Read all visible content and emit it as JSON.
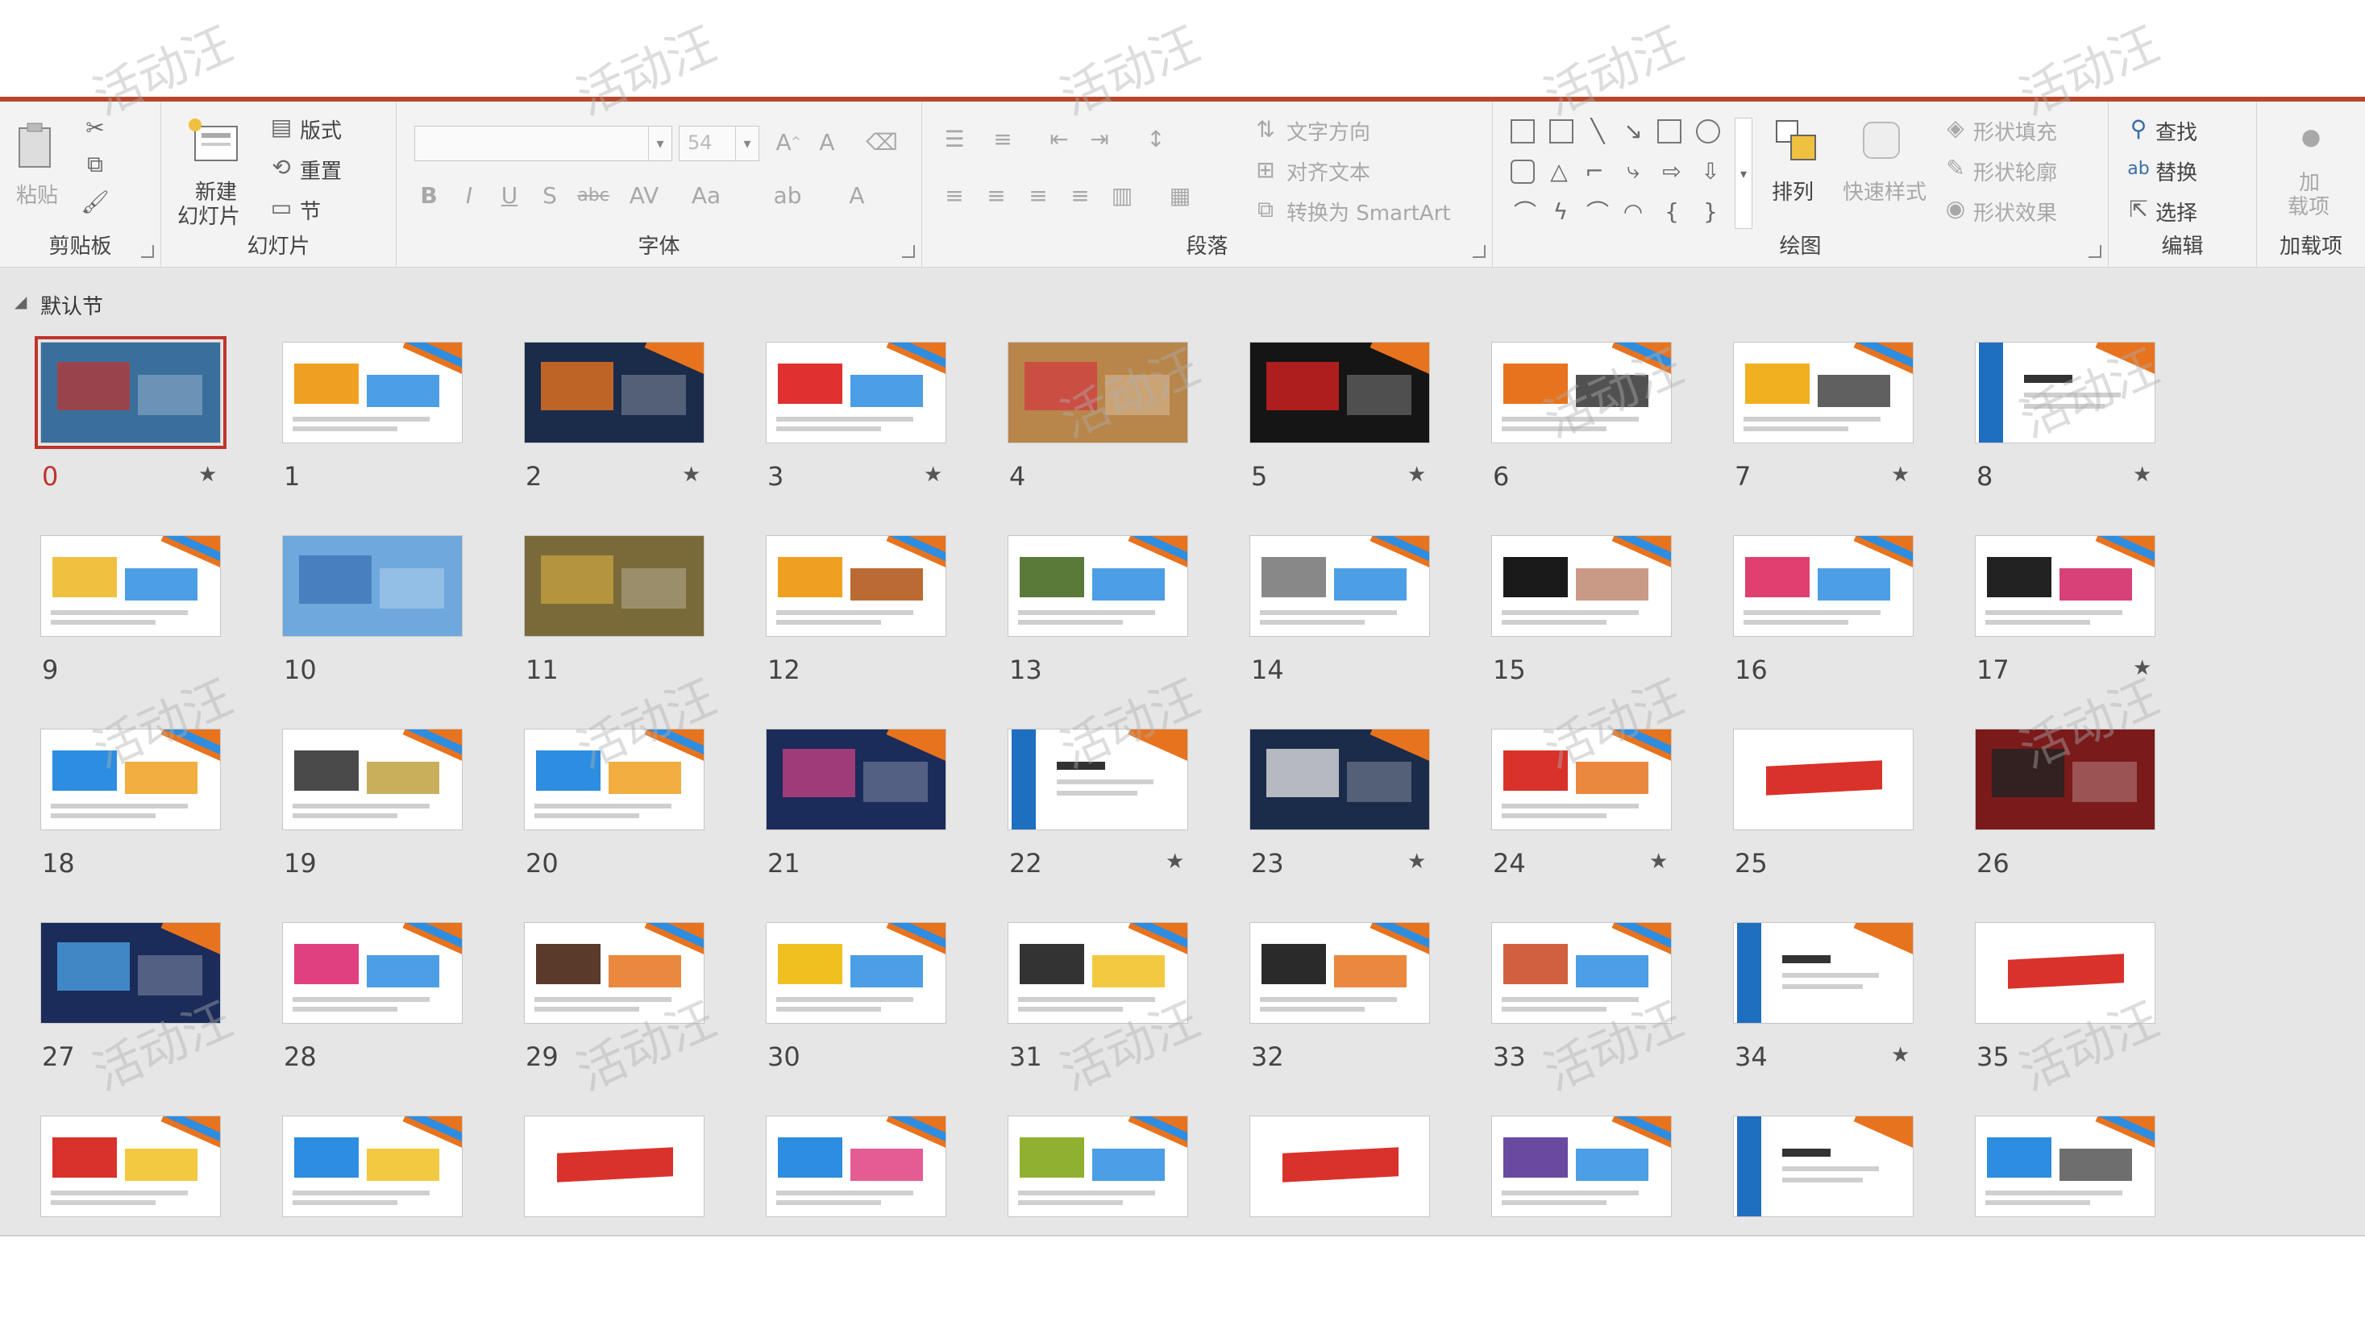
{
  "ribbon": {
    "clipboard": {
      "label": "剪贴板",
      "paste": "粘贴"
    },
    "slides": {
      "label": "幻灯片",
      "new_slide_line1": "新建",
      "new_slide_line2": "幻灯片",
      "layout": "版式",
      "reset": "重置",
      "section": "节"
    },
    "font": {
      "label": "字体",
      "font_name": "",
      "font_size": "54"
    },
    "paragraph": {
      "label": "段落",
      "text_direction": "文字方向",
      "align_text": "对齐文本",
      "convert_smartart": "转换为 SmartArt"
    },
    "drawing": {
      "label": "绘图",
      "arrange": "排列",
      "quick_styles": "快速样式",
      "shape_fill": "形状填充",
      "shape_outline": "形状轮廓",
      "shape_effects": "形状效果"
    },
    "editing": {
      "label": "编辑",
      "find": "查找",
      "replace": "替换",
      "select": "选择"
    },
    "addins": {
      "label": "加载项",
      "btn_line1": "加",
      "btn_line2": "载项"
    }
  },
  "section": {
    "name": "默认节"
  },
  "slides": [
    {
      "n": "0",
      "star": true,
      "style": "photo",
      "c1": "#3a6f9c",
      "c2": "#b23a3a"
    },
    {
      "n": "1",
      "star": false,
      "style": "white",
      "c1": "#f0a020",
      "c2": "#2d8de0"
    },
    {
      "n": "2",
      "star": true,
      "style": "dark",
      "c1": "#1b2b4a",
      "c2": "#e8731e"
    },
    {
      "n": "3",
      "star": true,
      "style": "white",
      "c1": "#e03030",
      "c2": "#2d8de0"
    },
    {
      "n": "4",
      "star": false,
      "style": "photo",
      "c1": "#b8864a",
      "c2": "#d04040"
    },
    {
      "n": "5",
      "star": true,
      "style": "dark",
      "c1": "#151515",
      "c2": "#d42020"
    },
    {
      "n": "6",
      "star": false,
      "style": "white",
      "c1": "#e8731e",
      "c2": "#333333"
    },
    {
      "n": "7",
      "star": true,
      "style": "white",
      "c1": "#f0b020",
      "c2": "#444444"
    },
    {
      "n": "8",
      "star": true,
      "style": "film",
      "c1": "#1f6fc0",
      "c2": "#e8731e"
    },
    {
      "n": "9",
      "star": false,
      "style": "white",
      "c1": "#f0c040",
      "c2": "#2d8de0"
    },
    {
      "n": "10",
      "star": false,
      "style": "photo",
      "c1": "#6fa8dc",
      "c2": "#3f76b8"
    },
    {
      "n": "11",
      "star": false,
      "style": "photo",
      "c1": "#7a6a3a",
      "c2": "#c0a040"
    },
    {
      "n": "12",
      "star": false,
      "style": "white",
      "c1": "#f0a020",
      "c2": "#b05010"
    },
    {
      "n": "13",
      "star": false,
      "style": "white",
      "c1": "#5a7a3a",
      "c2": "#2d8de0"
    },
    {
      "n": "14",
      "star": false,
      "style": "white",
      "c1": "#888888",
      "c2": "#2d8de0"
    },
    {
      "n": "15",
      "star": false,
      "style": "white",
      "c1": "#1a1a1a",
      "c2": "#c08870"
    },
    {
      "n": "16",
      "star": false,
      "style": "white",
      "c1": "#e04070",
      "c2": "#2d8de0"
    },
    {
      "n": "17",
      "star": true,
      "style": "white",
      "c1": "#222222",
      "c2": "#d02060"
    },
    {
      "n": "18",
      "star": false,
      "style": "white",
      "c1": "#2d8de0",
      "c2": "#f0a020"
    },
    {
      "n": "19",
      "star": false,
      "style": "white",
      "c1": "#4a4a4a",
      "c2": "#c0a040"
    },
    {
      "n": "20",
      "star": false,
      "style": "white",
      "c1": "#2d8de0",
      "c2": "#f0a020"
    },
    {
      "n": "21",
      "star": false,
      "style": "dark",
      "c1": "#1b2b5a",
      "c2": "#c04080"
    },
    {
      "n": "22",
      "star": true,
      "style": "film",
      "c1": "#1f6fc0",
      "c2": "#e8731e"
    },
    {
      "n": "23",
      "star": true,
      "style": "dark",
      "c1": "#1b2b4a",
      "c2": "#dddddd"
    },
    {
      "n": "24",
      "star": true,
      "style": "white",
      "c1": "#d9322b",
      "c2": "#e8731e"
    },
    {
      "n": "25",
      "star": false,
      "style": "ribbon",
      "c1": "#d9322b",
      "c2": "#e8731e"
    },
    {
      "n": "26",
      "star": false,
      "style": "photo",
      "c1": "#7a1a1a",
      "c2": "#222222"
    },
    {
      "n": "27",
      "star": false,
      "style": "dark",
      "c1": "#1b2b5a",
      "c2": "#4aa0e0"
    },
    {
      "n": "28",
      "star": false,
      "style": "white",
      "c1": "#e04080",
      "c2": "#2d8de0"
    },
    {
      "n": "29",
      "star": false,
      "style": "white",
      "c1": "#5a3a2a",
      "c2": "#e8731e"
    },
    {
      "n": "30",
      "star": false,
      "style": "white",
      "c1": "#f0c020",
      "c2": "#2d8de0"
    },
    {
      "n": "31",
      "star": false,
      "style": "white",
      "c1": "#333333",
      "c2": "#f0c020"
    },
    {
      "n": "32",
      "star": false,
      "style": "white",
      "c1": "#2a2a2a",
      "c2": "#e8731e"
    },
    {
      "n": "33",
      "star": false,
      "style": "white",
      "c1": "#d06040",
      "c2": "#2d8de0"
    },
    {
      "n": "34",
      "star": true,
      "style": "film",
      "c1": "#1f6fc0",
      "c2": "#e8731e"
    },
    {
      "n": "35",
      "star": false,
      "style": "ribbon",
      "c1": "#d9322b",
      "c2": "#e8731e"
    },
    {
      "n": "",
      "star": false,
      "style": "white",
      "c1": "#d9322b",
      "c2": "#f0c020"
    },
    {
      "n": "",
      "star": false,
      "style": "white",
      "c1": "#2d8de0",
      "c2": "#f0c020"
    },
    {
      "n": "",
      "star": false,
      "style": "ribbon",
      "c1": "#d9322b",
      "c2": "#e8731e"
    },
    {
      "n": "",
      "star": false,
      "style": "white",
      "c1": "#2d8de0",
      "c2": "#e04080"
    },
    {
      "n": "",
      "star": false,
      "style": "white",
      "c1": "#90b030",
      "c2": "#2d8de0"
    },
    {
      "n": "",
      "star": false,
      "style": "ribbon",
      "c1": "#d9322b",
      "c2": "#e8731e"
    },
    {
      "n": "",
      "star": false,
      "style": "white",
      "c1": "#6a4aa0",
      "c2": "#2d8de0"
    },
    {
      "n": "",
      "star": false,
      "style": "film",
      "c1": "#1f6fc0",
      "c2": "#e8731e"
    },
    {
      "n": "",
      "star": false,
      "style": "white",
      "c1": "#2d8de0",
      "c2": "#555555"
    }
  ],
  "colors": {
    "accent": "#b7472a",
    "selection": "#c0332b",
    "panel_bg": "#e6e6e6"
  }
}
